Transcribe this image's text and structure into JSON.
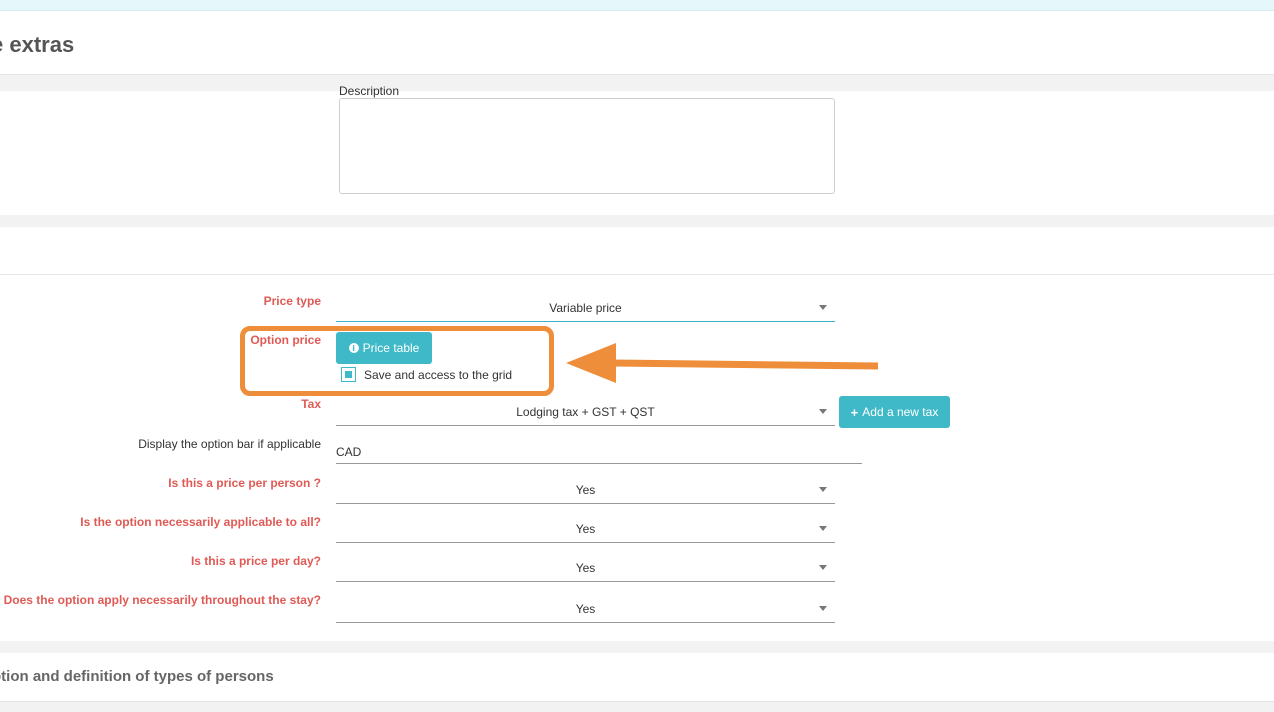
{
  "page": {
    "title": "e extras"
  },
  "description": {
    "label": "Description",
    "value": ""
  },
  "form": {
    "price_type": {
      "label": "Price type",
      "value": "Variable price"
    },
    "option_price": {
      "label": "Option price",
      "button_label": "Price table",
      "checkbox_label": "Save and access to the grid",
      "checked": true
    },
    "tax": {
      "label": "Tax",
      "value": "Lodging tax + GST + QST",
      "add_button_label": "Add a new tax"
    },
    "option_bar": {
      "label": "Display the option bar if applicable",
      "value": "CAD"
    },
    "per_person": {
      "label": "Is this a price per person ?",
      "value": "Yes"
    },
    "applicable_all": {
      "label": "Is the option necessarily applicable to all?",
      "value": "Yes"
    },
    "per_day": {
      "label": "Is this a price per day?",
      "value": "Yes"
    },
    "throughout_stay": {
      "label": "Does the option apply necessarily throughout the stay?",
      "value": "Yes"
    }
  },
  "next_section": {
    "title": "ption and definition of types of persons"
  },
  "colors": {
    "accent": "#3fb8c8",
    "required_label": "#e05a55",
    "annotation": "#ee8d3a"
  },
  "icons": {
    "info": "info-icon",
    "plus": "plus-icon",
    "caret": "chevron-down-icon",
    "arrow": "arrow-left-icon"
  }
}
